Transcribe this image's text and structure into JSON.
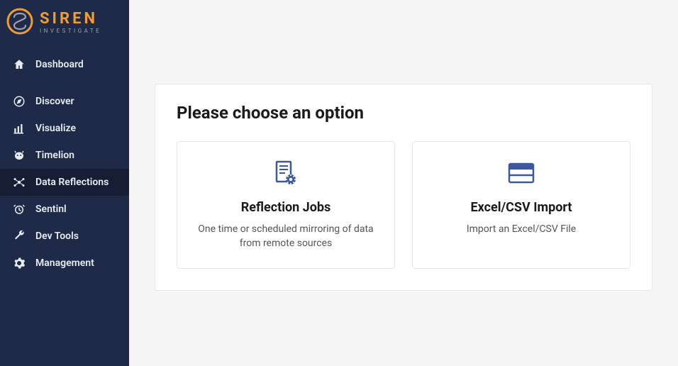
{
  "brand": {
    "title": "SIREN",
    "subtitle": "INVESTIGATE"
  },
  "sidebar": {
    "items": [
      {
        "label": "Dashboard"
      },
      {
        "label": "Discover"
      },
      {
        "label": "Visualize"
      },
      {
        "label": "Timelion"
      },
      {
        "label": "Data Reflections"
      },
      {
        "label": "Sentinl"
      },
      {
        "label": "Dev Tools"
      },
      {
        "label": "Management"
      }
    ]
  },
  "main": {
    "title": "Please choose an option",
    "cards": [
      {
        "title": "Reflection Jobs",
        "description": "One time or scheduled mirroring of data from remote sources"
      },
      {
        "title": "Excel/CSV Import",
        "description": "Import an Excel/CSV File"
      }
    ]
  }
}
